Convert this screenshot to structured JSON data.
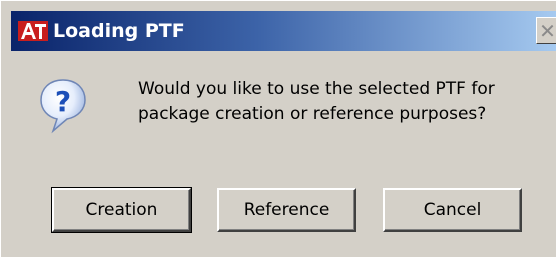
{
  "dialog": {
    "title": "Loading PTF",
    "app_icon": "att-logo-icon",
    "close_symbol": "✕",
    "message_icon": "question-icon",
    "message_lines": [
      "Would you like to use the selected PTF for",
      "package creation or reference purposes?"
    ],
    "buttons": {
      "creation": "Creation",
      "reference": "Reference",
      "cancel": "Cancel"
    }
  },
  "colors": {
    "titlebar_start": "#0a246a",
    "titlebar_end": "#a6caf0",
    "window_face": "#d4d0c8",
    "question_bubble": "#1c5fcf"
  }
}
